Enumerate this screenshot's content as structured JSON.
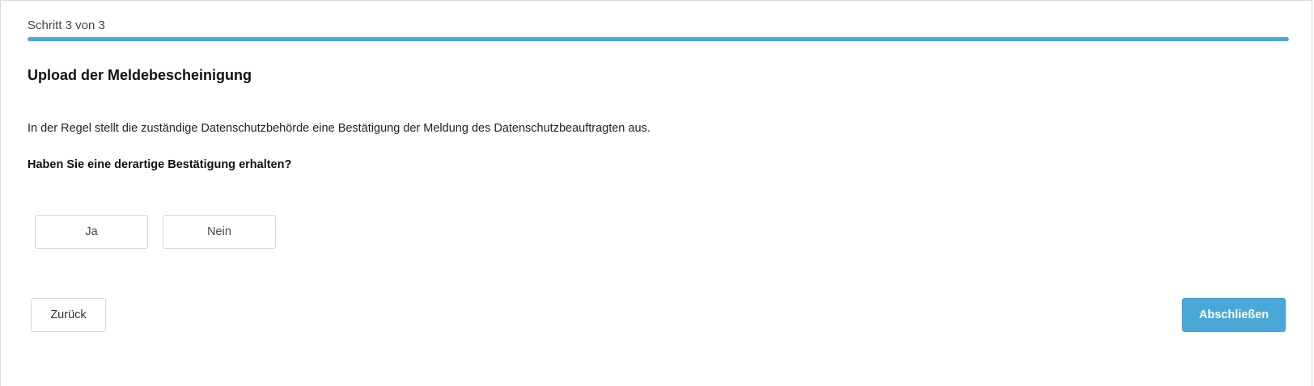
{
  "wizard": {
    "step_label": "Schritt 3 von 3",
    "progress_fraction": 1.0,
    "accent_color": "#4aa8d8"
  },
  "section": {
    "title": "Upload der Meldebescheinigung",
    "description": "In der Regel stellt die zuständige Datenschutzbehörde eine Bestätigung der Meldung des Datenschutzbeauftragten aus.",
    "question": "Haben Sie eine derartige Bestätigung erhalten?"
  },
  "choices": {
    "yes_label": "Ja",
    "no_label": "Nein"
  },
  "footer": {
    "back_label": "Zurück",
    "finish_label": "Abschließen"
  }
}
